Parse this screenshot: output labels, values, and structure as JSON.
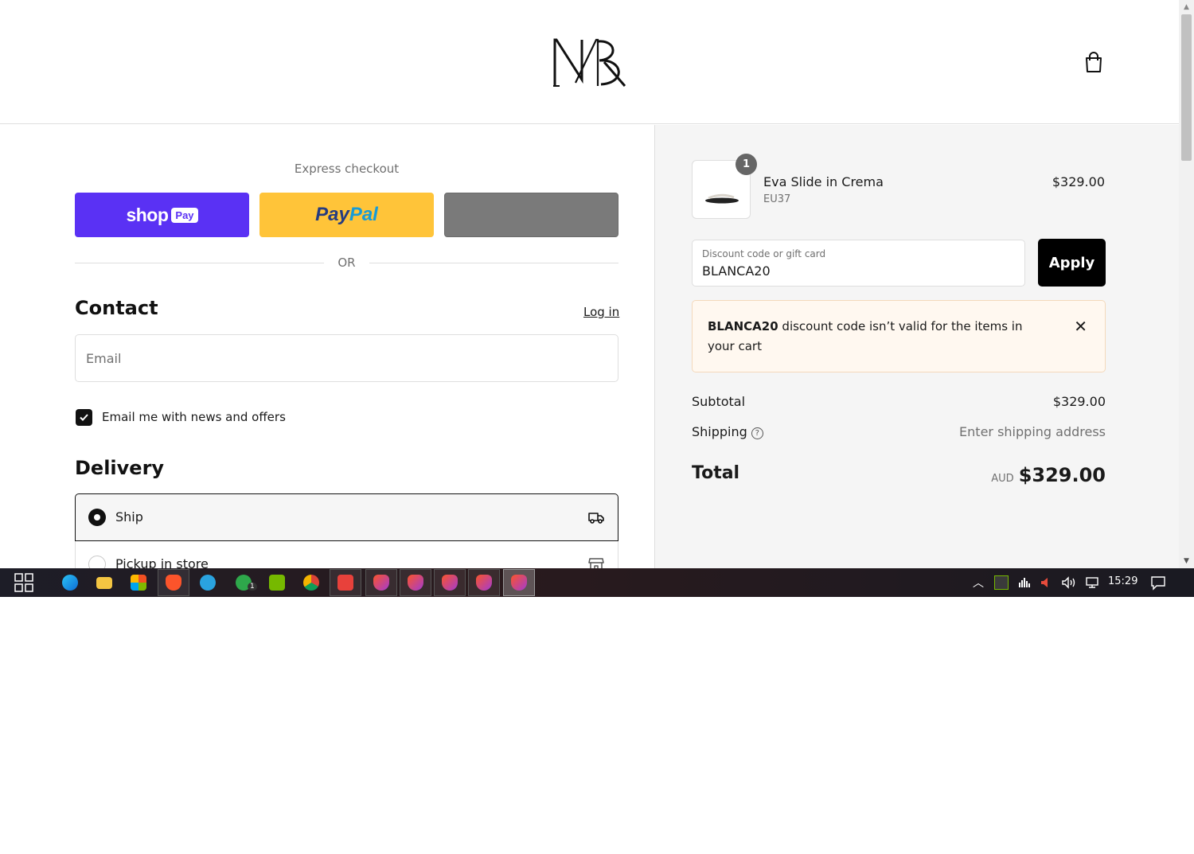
{
  "store": {
    "logo_text": "MB",
    "cart_icon": "shopping-bag-icon"
  },
  "express": {
    "title": "Express checkout",
    "shop_pay_label": "shop",
    "shop_pay_pill": "Pay",
    "paypal_part1": "Pay",
    "paypal_part2": "Pal",
    "or_label": "OR"
  },
  "contact": {
    "heading": "Contact",
    "login_link": "Log in",
    "email_placeholder": "Email",
    "newsletter_label": "Email me with news and offers",
    "newsletter_checked": true
  },
  "delivery": {
    "heading": "Delivery",
    "options": [
      {
        "label": "Ship",
        "selected": true,
        "icon": "truck-icon"
      },
      {
        "label": "Pickup in store",
        "selected": false,
        "icon": "store-icon"
      }
    ]
  },
  "summary": {
    "item": {
      "quantity": "1",
      "name": "Eva Slide in Crema",
      "variant": "EU37",
      "price": "$329.00"
    },
    "discount": {
      "label": "Discount code or gift card",
      "value": "BLANCA20",
      "apply_label": "Apply"
    },
    "error": {
      "code": "BLANCA20",
      "message": " discount code isn’t valid for the items in your cart"
    },
    "subtotal_label": "Subtotal",
    "subtotal_value": "$329.00",
    "shipping_label": "Shipping",
    "shipping_value": "Enter shipping address",
    "total_label": "Total",
    "total_currency": "AUD",
    "total_value": "$329.00"
  },
  "colors": {
    "shop_pay": "#5a31f4",
    "paypal": "#ffc439",
    "error_bg": "#fff8f0"
  },
  "taskbar": {
    "clock": "15:29",
    "whatsapp_badge": "1"
  }
}
